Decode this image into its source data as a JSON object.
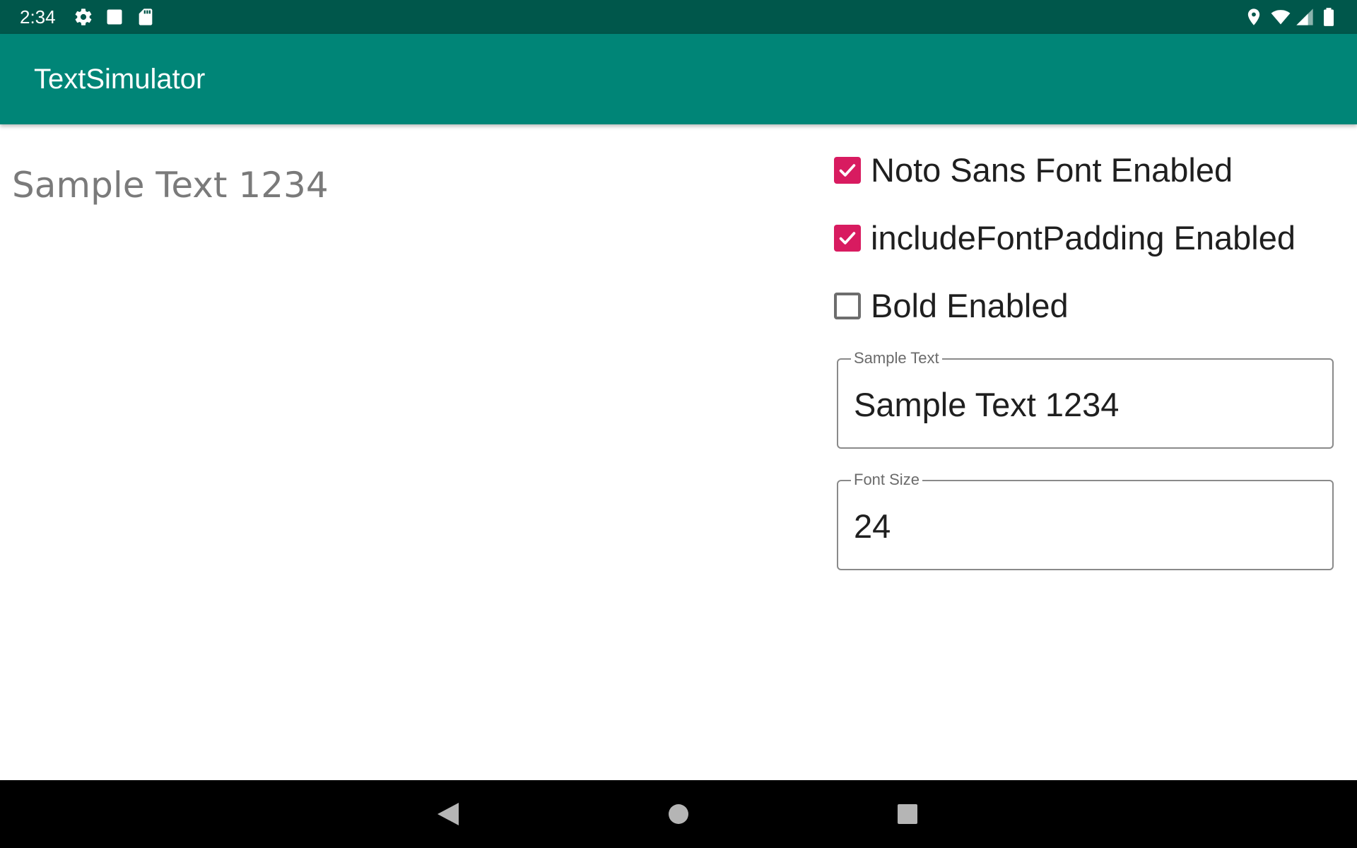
{
  "status_bar": {
    "time": "2:34",
    "left_icons": [
      "gear-icon",
      "notification-square-icon",
      "sd-card-icon"
    ],
    "right_icons": [
      "location-icon",
      "wifi-icon",
      "cell-signal-icon",
      "battery-icon"
    ]
  },
  "app_bar": {
    "title": "TextSimulator",
    "color": "#008577"
  },
  "preview": {
    "text": "Sample Text 1234"
  },
  "options": [
    {
      "label": "Noto Sans Font Enabled",
      "checked": true
    },
    {
      "label": "includeFontPadding Enabled",
      "checked": true
    },
    {
      "label": "Bold Enabled",
      "checked": false
    }
  ],
  "fields": {
    "sample_text": {
      "label": "Sample Text",
      "value": "Sample Text 1234"
    },
    "font_size": {
      "label": "Font Size",
      "value": "24"
    }
  },
  "nav_bar": {
    "buttons": [
      "back-icon",
      "home-icon",
      "recents-icon"
    ]
  },
  "colors": {
    "status_bar": "#00574b",
    "accent": "#d81b60"
  }
}
